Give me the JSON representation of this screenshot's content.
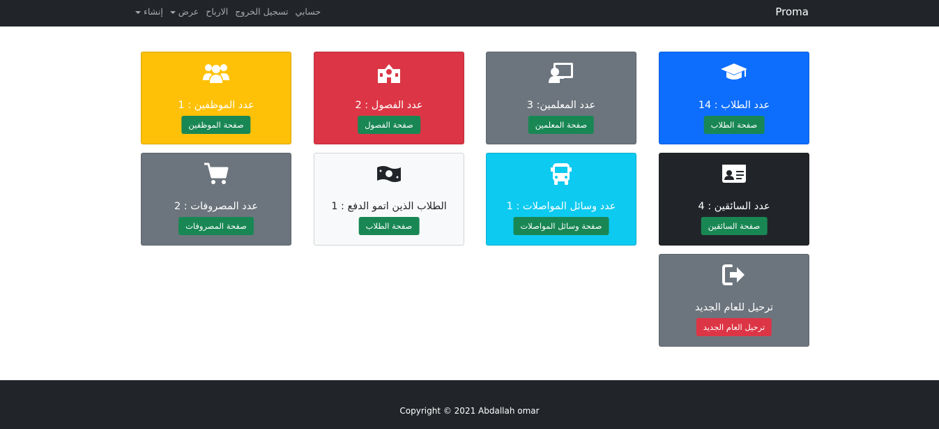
{
  "navbar": {
    "brand": "Proma",
    "links": [
      {
        "label": "إنشاء",
        "dropdown": true
      },
      {
        "label": "عرض",
        "dropdown": true
      },
      {
        "label": "الارباح",
        "dropdown": false
      },
      {
        "label": "تسجيل الخروج",
        "dropdown": false
      },
      {
        "label": "حسابي",
        "dropdown": false
      }
    ]
  },
  "cards": [
    {
      "title": "عدد الطلاب : 14",
      "button": "صفحة الطلاب",
      "icon": "graduation-cap-icon",
      "bg": "#0d6efd",
      "color": "#ffffff"
    },
    {
      "title": "عدد المعلمين: 3",
      "button": "صفحة المعلمين",
      "icon": "teacher-icon",
      "bg": "#6c757d",
      "color": "#ffffff"
    },
    {
      "title": "عدد الفصول : 2",
      "button": "صفحة الفصول",
      "icon": "school-icon",
      "bg": "#dc3545",
      "color": "#ffffff"
    },
    {
      "title": "عدد الموظفين : 1",
      "button": "صفحة الموظفين",
      "icon": "users-icon",
      "bg": "#ffc107",
      "color": "#ffffff"
    },
    {
      "title": "عدد السائقين : 4",
      "button": "صفحة السائقين",
      "icon": "id-card-icon",
      "bg": "#212529",
      "color": "#ffffff"
    },
    {
      "title": "عدد وسائل المواصلات : 1",
      "button": "صفحة وسائل المواصلات",
      "icon": "bus-icon",
      "bg": "#0dcaf0",
      "color": "#ffffff"
    },
    {
      "title": "الطلاب الذين اتمو الدفع : 1",
      "button": "صفحة الطلاب",
      "icon": "money-bill-icon",
      "bg": "#f8f9fa",
      "color": "#212529"
    },
    {
      "title": "عدد المصروفات : 2",
      "button": "صفحة المصروفات",
      "icon": "cart-icon",
      "bg": "#6c757d",
      "color": "#ffffff"
    },
    {
      "title": "ترحيل للعام الجديد",
      "button": "ترحيل العام الجديد",
      "icon": "sign-out-icon",
      "bg": "#6c757d",
      "color": "#ffffff",
      "button_color": "#dc3545"
    }
  ],
  "footer": {
    "copyright": "Copyright © 2021 Abdallah omar"
  }
}
